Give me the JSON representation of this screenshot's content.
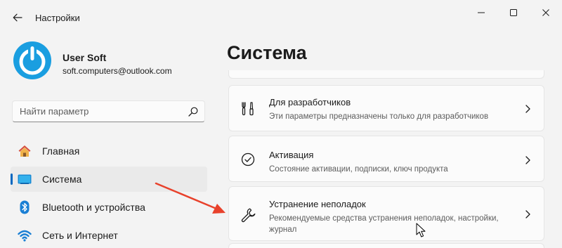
{
  "window": {
    "title": "Настройки"
  },
  "profile": {
    "name": "User Soft",
    "email": "soft.computers@outlook.com"
  },
  "search": {
    "placeholder": "Найти параметр",
    "value": ""
  },
  "sidebar": {
    "items": [
      {
        "label": "Главная",
        "icon": "home-icon",
        "active": false
      },
      {
        "label": "Система",
        "icon": "system-icon",
        "active": true
      },
      {
        "label": "Bluetooth и устройства",
        "icon": "bluetooth-icon",
        "active": false
      },
      {
        "label": "Сеть и Интернет",
        "icon": "wifi-icon",
        "active": false
      }
    ]
  },
  "main": {
    "title": "Система",
    "cards": [
      {
        "title": "Для разработчиков",
        "description": "Эти параметры предназначены только для разработчиков",
        "icon": "developer-tools-icon"
      },
      {
        "title": "Активация",
        "description": "Состояние активации, подписки, ключ продукта",
        "icon": "activation-check-icon"
      },
      {
        "title": "Устранение неполадок",
        "description": "Рекомендуемые средства устранения неполадок, настройки, журнал",
        "icon": "wrench-icon"
      }
    ]
  },
  "colors": {
    "accent": "#0067c0",
    "background": "#f3f3f3",
    "card": "#fbfbfb",
    "annotation_arrow": "#e8412b",
    "avatar_blue": "#1a9ee0"
  }
}
